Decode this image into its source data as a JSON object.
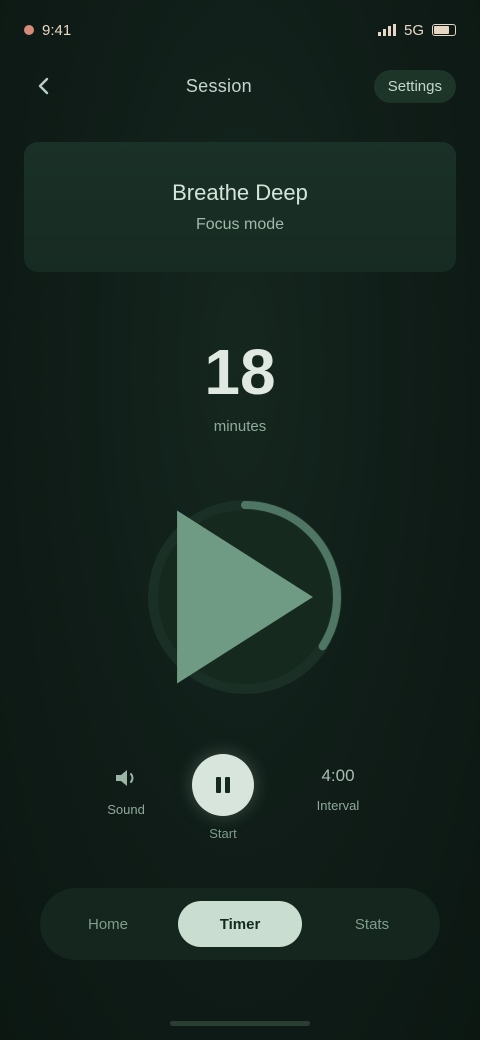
{
  "status_bar": {
    "time": "9:41",
    "carrier": "5G"
  },
  "header": {
    "back_icon": "chevron-left-icon",
    "title": "Session",
    "action_label": "Settings"
  },
  "banner": {
    "title": "Breathe Deep",
    "subtitle": "Focus mode"
  },
  "counter": {
    "value": "18",
    "label": "minutes"
  },
  "dial": {
    "progress_fraction": 0.34,
    "center_icon": "play-icon",
    "track_color": "#1a2f25",
    "progress_color": "#4f7664"
  },
  "controls": {
    "left_icon": "sound-icon",
    "left_label": "Sound",
    "main_icon": "pause-icon",
    "main_label": "Start",
    "right_value": "4:00",
    "right_label": "Interval"
  },
  "nav": {
    "items": [
      {
        "label": "Home"
      },
      {
        "label": "Timer"
      },
      {
        "label": "Stats"
      }
    ],
    "active_index": 1
  }
}
